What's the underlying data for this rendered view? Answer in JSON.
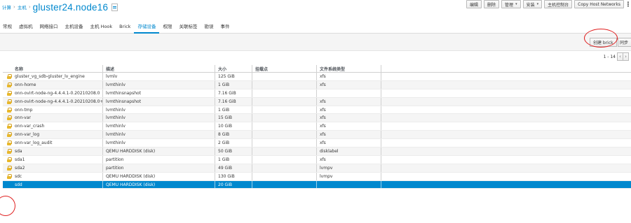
{
  "breadcrumb": {
    "compute": "计算",
    "hosts": "主机",
    "title": "gluster24.node16"
  },
  "actions": {
    "edit": "编辑",
    "remove": "删除",
    "management": "管理",
    "installation": "安装",
    "host_console": "主机控制台",
    "copy_host_networks": "Copy Host Networks"
  },
  "tabs": [
    "常规",
    "虚拟机",
    "网络接口",
    "主机设备",
    "主机 Hook",
    "Brick",
    "存储设备",
    "权限",
    "关联标签",
    "勘误",
    "事件"
  ],
  "active_tab": "存储设备",
  "toolbar": {
    "new_brick": "创建 brick",
    "sync": "同步"
  },
  "pager": {
    "range": "1 - 14"
  },
  "colors": {
    "accent": "#0088ce",
    "selected_row": "#0088ce",
    "annotation": "#e02020",
    "lock": "#e8b72a"
  },
  "table": {
    "columns": [
      "名称",
      "描述",
      "大小",
      "挂载点",
      "文件系统类型"
    ],
    "rows": [
      {
        "locked": true,
        "name": "gluster_vg_sdb-gluster_lv_engine",
        "desc": "lvmlv",
        "size": "125 GiB",
        "mount": "",
        "fs": "xfs"
      },
      {
        "locked": true,
        "name": "onn-home",
        "desc": "lvmthinlv",
        "size": "1 GiB",
        "mount": "",
        "fs": "xfs"
      },
      {
        "locked": true,
        "name": "onn-ovirt-node-ng-4.4.4.1-0.20210208.0",
        "desc": "lvmthinsnapshot",
        "size": "7.16 GiB",
        "mount": "",
        "fs": ""
      },
      {
        "locked": true,
        "name": "onn-ovirt-node-ng-4.4.4.1-0.20210208.0+1",
        "desc": "lvmthinsnapshot",
        "size": "7.16 GiB",
        "mount": "",
        "fs": "xfs"
      },
      {
        "locked": true,
        "name": "onn-tmp",
        "desc": "lvmthinlv",
        "size": "1 GiB",
        "mount": "",
        "fs": "xfs"
      },
      {
        "locked": true,
        "name": "onn-var",
        "desc": "lvmthinlv",
        "size": "15 GiB",
        "mount": "",
        "fs": "xfs"
      },
      {
        "locked": true,
        "name": "onn-var_crash",
        "desc": "lvmthinlv",
        "size": "10 GiB",
        "mount": "",
        "fs": "xfs"
      },
      {
        "locked": true,
        "name": "onn-var_log",
        "desc": "lvmthinlv",
        "size": "8 GiB",
        "mount": "",
        "fs": "xfs"
      },
      {
        "locked": true,
        "name": "onn-var_log_audit",
        "desc": "lvmthinlv",
        "size": "2 GiB",
        "mount": "",
        "fs": "xfs"
      },
      {
        "locked": true,
        "name": "sda",
        "desc": "QEMU HARDDISK (disk)",
        "size": "50 GiB",
        "mount": "",
        "fs": "disklabel"
      },
      {
        "locked": true,
        "name": "sda1",
        "desc": "partition",
        "size": "1 GiB",
        "mount": "",
        "fs": "xfs"
      },
      {
        "locked": true,
        "name": "sda2",
        "desc": "partition",
        "size": "49 GiB",
        "mount": "",
        "fs": "lvmpv"
      },
      {
        "locked": true,
        "name": "sdc",
        "desc": "QEMU HARDDISK (disk)",
        "size": "130 GiB",
        "mount": "",
        "fs": "lvmpv"
      },
      {
        "locked": false,
        "name": "sdd",
        "desc": "QEMU HARDDISK (disk)",
        "size": "20 GiB",
        "mount": "",
        "fs": "",
        "selected": true
      }
    ]
  }
}
